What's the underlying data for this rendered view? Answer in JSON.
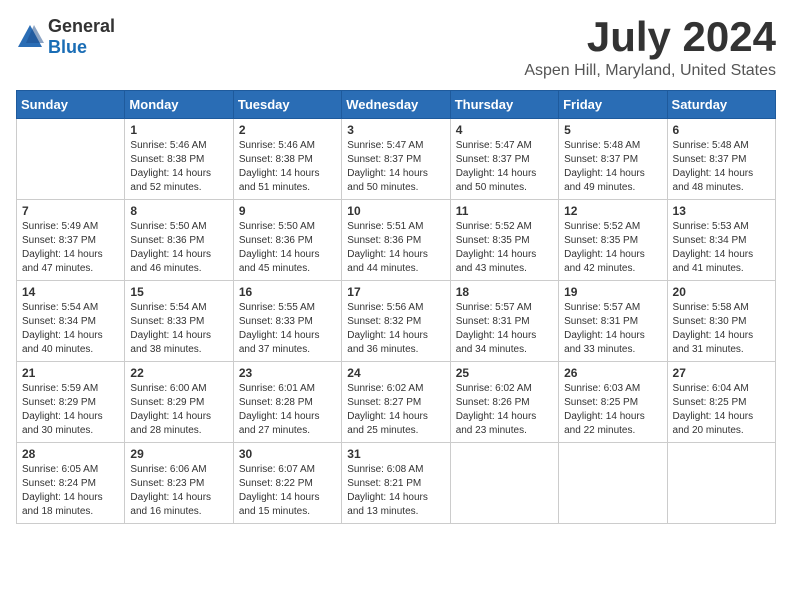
{
  "logo": {
    "general": "General",
    "blue": "Blue"
  },
  "header": {
    "month": "July 2024",
    "location": "Aspen Hill, Maryland, United States"
  },
  "days_of_week": [
    "Sunday",
    "Monday",
    "Tuesday",
    "Wednesday",
    "Thursday",
    "Friday",
    "Saturday"
  ],
  "weeks": [
    [
      {
        "day": "",
        "info": ""
      },
      {
        "day": "1",
        "info": "Sunrise: 5:46 AM\nSunset: 8:38 PM\nDaylight: 14 hours\nand 52 minutes."
      },
      {
        "day": "2",
        "info": "Sunrise: 5:46 AM\nSunset: 8:38 PM\nDaylight: 14 hours\nand 51 minutes."
      },
      {
        "day": "3",
        "info": "Sunrise: 5:47 AM\nSunset: 8:37 PM\nDaylight: 14 hours\nand 50 minutes."
      },
      {
        "day": "4",
        "info": "Sunrise: 5:47 AM\nSunset: 8:37 PM\nDaylight: 14 hours\nand 50 minutes."
      },
      {
        "day": "5",
        "info": "Sunrise: 5:48 AM\nSunset: 8:37 PM\nDaylight: 14 hours\nand 49 minutes."
      },
      {
        "day": "6",
        "info": "Sunrise: 5:48 AM\nSunset: 8:37 PM\nDaylight: 14 hours\nand 48 minutes."
      }
    ],
    [
      {
        "day": "7",
        "info": "Sunrise: 5:49 AM\nSunset: 8:37 PM\nDaylight: 14 hours\nand 47 minutes."
      },
      {
        "day": "8",
        "info": "Sunrise: 5:50 AM\nSunset: 8:36 PM\nDaylight: 14 hours\nand 46 minutes."
      },
      {
        "day": "9",
        "info": "Sunrise: 5:50 AM\nSunset: 8:36 PM\nDaylight: 14 hours\nand 45 minutes."
      },
      {
        "day": "10",
        "info": "Sunrise: 5:51 AM\nSunset: 8:36 PM\nDaylight: 14 hours\nand 44 minutes."
      },
      {
        "day": "11",
        "info": "Sunrise: 5:52 AM\nSunset: 8:35 PM\nDaylight: 14 hours\nand 43 minutes."
      },
      {
        "day": "12",
        "info": "Sunrise: 5:52 AM\nSunset: 8:35 PM\nDaylight: 14 hours\nand 42 minutes."
      },
      {
        "day": "13",
        "info": "Sunrise: 5:53 AM\nSunset: 8:34 PM\nDaylight: 14 hours\nand 41 minutes."
      }
    ],
    [
      {
        "day": "14",
        "info": "Sunrise: 5:54 AM\nSunset: 8:34 PM\nDaylight: 14 hours\nand 40 minutes."
      },
      {
        "day": "15",
        "info": "Sunrise: 5:54 AM\nSunset: 8:33 PM\nDaylight: 14 hours\nand 38 minutes."
      },
      {
        "day": "16",
        "info": "Sunrise: 5:55 AM\nSunset: 8:33 PM\nDaylight: 14 hours\nand 37 minutes."
      },
      {
        "day": "17",
        "info": "Sunrise: 5:56 AM\nSunset: 8:32 PM\nDaylight: 14 hours\nand 36 minutes."
      },
      {
        "day": "18",
        "info": "Sunrise: 5:57 AM\nSunset: 8:31 PM\nDaylight: 14 hours\nand 34 minutes."
      },
      {
        "day": "19",
        "info": "Sunrise: 5:57 AM\nSunset: 8:31 PM\nDaylight: 14 hours\nand 33 minutes."
      },
      {
        "day": "20",
        "info": "Sunrise: 5:58 AM\nSunset: 8:30 PM\nDaylight: 14 hours\nand 31 minutes."
      }
    ],
    [
      {
        "day": "21",
        "info": "Sunrise: 5:59 AM\nSunset: 8:29 PM\nDaylight: 14 hours\nand 30 minutes."
      },
      {
        "day": "22",
        "info": "Sunrise: 6:00 AM\nSunset: 8:29 PM\nDaylight: 14 hours\nand 28 minutes."
      },
      {
        "day": "23",
        "info": "Sunrise: 6:01 AM\nSunset: 8:28 PM\nDaylight: 14 hours\nand 27 minutes."
      },
      {
        "day": "24",
        "info": "Sunrise: 6:02 AM\nSunset: 8:27 PM\nDaylight: 14 hours\nand 25 minutes."
      },
      {
        "day": "25",
        "info": "Sunrise: 6:02 AM\nSunset: 8:26 PM\nDaylight: 14 hours\nand 23 minutes."
      },
      {
        "day": "26",
        "info": "Sunrise: 6:03 AM\nSunset: 8:25 PM\nDaylight: 14 hours\nand 22 minutes."
      },
      {
        "day": "27",
        "info": "Sunrise: 6:04 AM\nSunset: 8:25 PM\nDaylight: 14 hours\nand 20 minutes."
      }
    ],
    [
      {
        "day": "28",
        "info": "Sunrise: 6:05 AM\nSunset: 8:24 PM\nDaylight: 14 hours\nand 18 minutes."
      },
      {
        "day": "29",
        "info": "Sunrise: 6:06 AM\nSunset: 8:23 PM\nDaylight: 14 hours\nand 16 minutes."
      },
      {
        "day": "30",
        "info": "Sunrise: 6:07 AM\nSunset: 8:22 PM\nDaylight: 14 hours\nand 15 minutes."
      },
      {
        "day": "31",
        "info": "Sunrise: 6:08 AM\nSunset: 8:21 PM\nDaylight: 14 hours\nand 13 minutes."
      },
      {
        "day": "",
        "info": ""
      },
      {
        "day": "",
        "info": ""
      },
      {
        "day": "",
        "info": ""
      }
    ]
  ]
}
